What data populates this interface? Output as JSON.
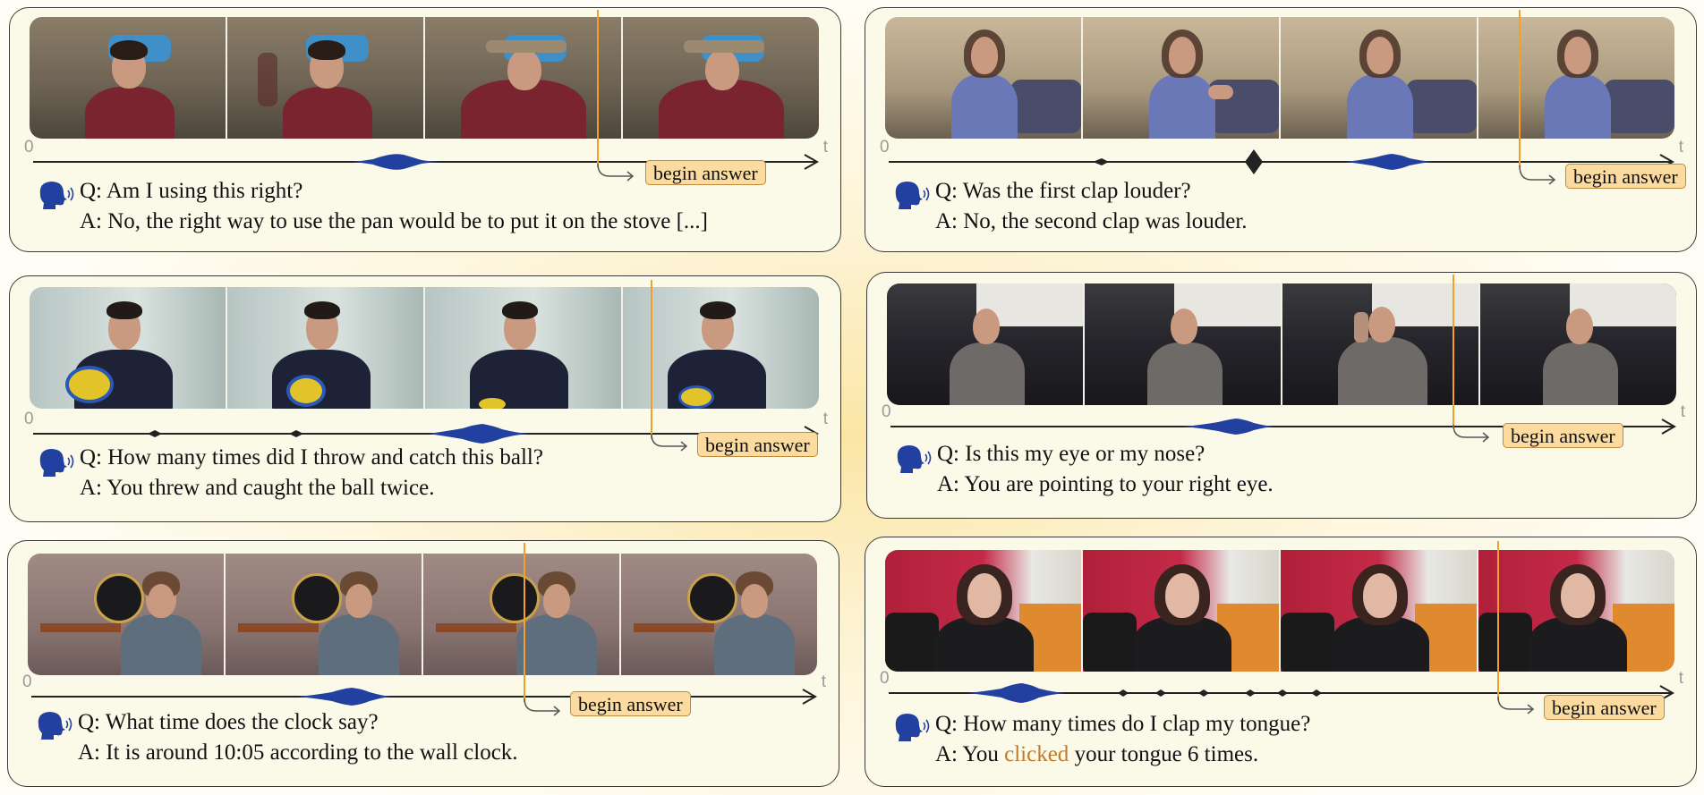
{
  "colors": {
    "speech_blue": "#2240a0",
    "begin_marker": "#f2a02b",
    "answer_badge_fill": "#fbdba0",
    "highlight_word": "#c17a2a",
    "panel_fill": "#fbf9e8"
  },
  "icons": {
    "speaker": "speaking-head-icon"
  },
  "axis": {
    "start": "0",
    "end": "t"
  },
  "examples": [
    {
      "question": "Q: Am I using this right?",
      "answer": "A: No, the right way to use the pan would be to put it on the stove [...]",
      "begin_answer": "begin answer",
      "scene": "kitchen, man holding pan"
    },
    {
      "question": "Q: Was the first clap louder?",
      "answer": "A: No, the second clap was louder.",
      "begin_answer": "begin answer",
      "scene": "bedroom, woman clapping"
    },
    {
      "question": "Q: How many times did I throw and catch this ball?",
      "answer": "A: You threw and caught the ball twice.",
      "begin_answer": "begin answer",
      "scene": "room, man with ball"
    },
    {
      "question": "Q: Is this my eye or my nose?",
      "answer": "A: You are pointing to your right eye.",
      "begin_answer": "begin answer",
      "scene": "dark kitchen, man pointing"
    },
    {
      "question": "Q: What time does the clock say?",
      "answer": "A: It is around 10:05 according to the wall clock.",
      "begin_answer": "begin answer",
      "scene": "room with wall clock, woman"
    },
    {
      "question": "Q: How many times do I clap my tongue?",
      "answer_before": "A: You ",
      "answer_highlight": "clicked",
      "answer_after": " your tongue 6 times.",
      "begin_answer": "begin answer",
      "scene": "office shelves, woman"
    }
  ]
}
